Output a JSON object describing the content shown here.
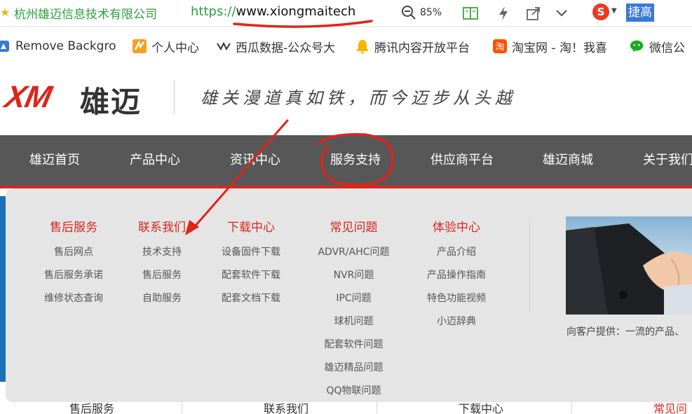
{
  "browser": {
    "site_name": "杭州雄迈信息技术有限公司",
    "url_protocol": "https://",
    "url_host": "www.xiongmaitech",
    "zoom": "85%",
    "search_selected_text": "捷高",
    "toolbar_icons": [
      "star-icon",
      "zoom-icon",
      "reader-icon",
      "lightning-icon",
      "share-icon",
      "chevron-down-icon",
      "sogou-icon"
    ]
  },
  "bookmarks": [
    {
      "label": "Remove Backgro",
      "icon": "remove-bg-icon"
    },
    {
      "label": "个人中心",
      "icon": "zhihu-orange-icon"
    },
    {
      "label": "西瓜数据-公众号大",
      "icon": "xigua-icon"
    },
    {
      "label": "腾讯内容开放平台",
      "icon": "tencent-bell-icon"
    },
    {
      "label": "淘宝网 - 淘！我喜",
      "icon": "taobao-icon"
    },
    {
      "label": "微信公",
      "icon": "wechat-icon"
    }
  ],
  "header": {
    "logo_latin": "XM",
    "logo_cn": "雄迈",
    "slogan": "雄关漫道真如铁，而今迈步从头越"
  },
  "nav": {
    "items": [
      "雄迈首页",
      "产品中心",
      "资讯中心",
      "服务支持",
      "供应商平台",
      "雄迈商城",
      "关于我们"
    ]
  },
  "dropdown": {
    "columns": [
      {
        "title": "售后服务",
        "links": [
          "售后网点",
          "售后服务承诺",
          "维修状态查询"
        ]
      },
      {
        "title": "联系我们",
        "links": [
          "技术支持",
          "售后服务",
          "自助服务"
        ]
      },
      {
        "title": "下载中心",
        "links": [
          "设备固件下载",
          "配套软件下载",
          "配套文档下载"
        ]
      },
      {
        "title": "常见问题",
        "links": [
          "ADVR/AHC问题",
          "NVR问题",
          "IPC问题",
          "球机问题",
          "配套软件问题",
          "雄迈精品问题",
          "QQ物联问题"
        ]
      },
      {
        "title": "体验中心",
        "links": [
          "产品介绍",
          "产品操作指南",
          "特色功能视频",
          "小迈辞典"
        ]
      }
    ],
    "promo_caption": "向客户提供：一流的产品、"
  },
  "bottom_tabs": [
    {
      "label": "售后服务",
      "active": false
    },
    {
      "label": "联系我们",
      "active": false
    },
    {
      "label": "下载中心",
      "active": false
    },
    {
      "label": "常见问",
      "active": true
    }
  ],
  "colors": {
    "brand_red": "#d9261c",
    "nav_bg": "#575757",
    "dropdown_bg": "#e5e5e5",
    "url_green": "#2e9e3e",
    "annotation_red": "#e0241b"
  }
}
